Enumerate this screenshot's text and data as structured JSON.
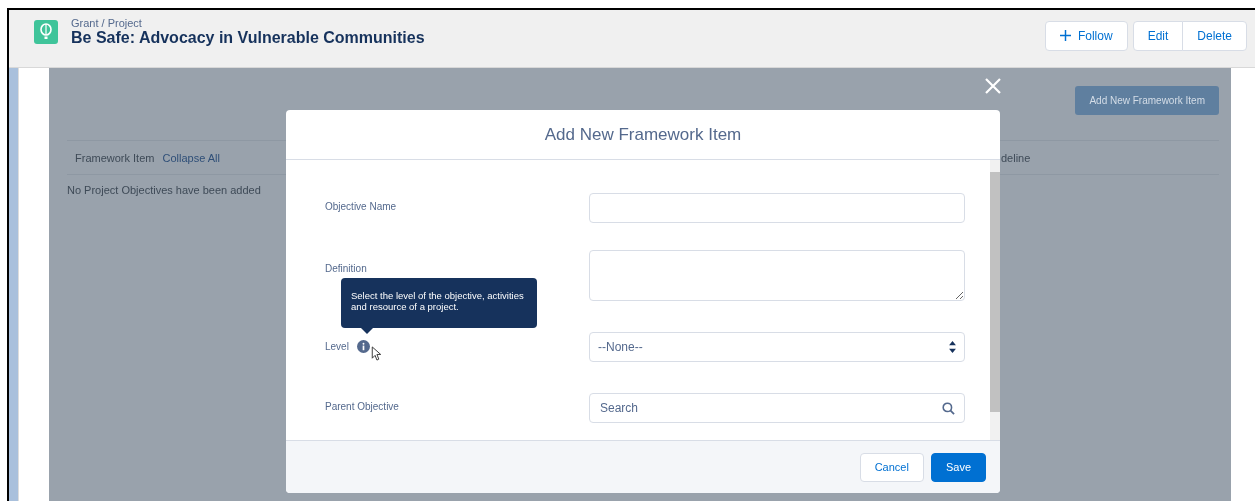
{
  "header": {
    "breadcrumb": "Grant / Project",
    "title": "Be Safe: Advocacy in Vulnerable Communities",
    "buttons": [
      {
        "label": "Follow",
        "kind": "follow"
      },
      {
        "label": "Edit",
        "kind": "plain"
      },
      {
        "label": "Delete",
        "kind": "plain"
      }
    ]
  },
  "background": {
    "add_button": "Add New Framework Item",
    "columns": [
      "Framework Item",
      "Collapse All",
      "deline"
    ],
    "empty_message": "No Project Objectives have been added"
  },
  "modal": {
    "title": "Add New Framework Item",
    "fields": [
      {
        "label": "Objective Name",
        "kind": "text"
      },
      {
        "label": "Definition",
        "kind": "textarea"
      },
      {
        "label": "Level",
        "kind": "select",
        "value": "--None--",
        "info": true
      },
      {
        "label": "Parent Objective",
        "kind": "lookup",
        "placeholder": "Search"
      }
    ],
    "tooltip": "Select the level of the objective, activities and resource of a project.",
    "buttons": [
      {
        "label": "Cancel",
        "kind": "neutral"
      },
      {
        "label": "Save",
        "kind": "brand"
      }
    ]
  }
}
